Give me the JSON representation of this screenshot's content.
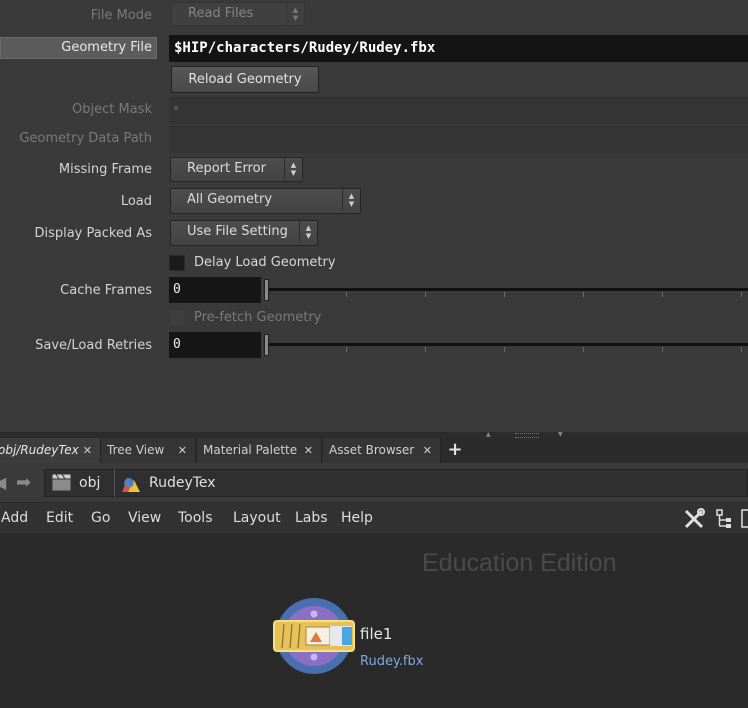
{
  "params": {
    "file_mode": {
      "label": "File Mode",
      "value": "Read Files"
    },
    "geometry_file": {
      "label": "Geometry File",
      "value": "$HIP/characters/Rudey/Rudey.fbx"
    },
    "reload_button": "Reload Geometry",
    "object_mask": {
      "label": "Object Mask",
      "value": "*"
    },
    "geometry_data_path": {
      "label": "Geometry Data Path"
    },
    "missing_frame": {
      "label": "Missing Frame",
      "value": "Report Error"
    },
    "load": {
      "label": "Load",
      "value": "All Geometry"
    },
    "display_packed_as": {
      "label": "Display Packed As",
      "value": "Use File Setting"
    },
    "delay_load": {
      "label": "Delay Load Geometry",
      "checked": false
    },
    "cache_frames": {
      "label": "Cache Frames",
      "value": "0"
    },
    "prefetch": {
      "label": "Pre-fetch Geometry",
      "checked": false
    },
    "save_load_retries": {
      "label": "Save/Load Retries",
      "value": "0"
    }
  },
  "tabs": [
    {
      "label": "obj/RudeyTex",
      "active": true
    },
    {
      "label": "Tree View"
    },
    {
      "label": "Material Palette"
    },
    {
      "label": "Asset Browser"
    }
  ],
  "path": [
    "obj",
    "RudeyTex"
  ],
  "menu": [
    "Add",
    "Edit",
    "Go",
    "View",
    "Tools",
    "Layout",
    "Labs",
    "Help"
  ],
  "network": {
    "watermark": "Education Edition",
    "node": {
      "name": "file1",
      "sublabel": "Rudey.fbx"
    }
  },
  "colors": {
    "node_ring": "#4a6fb0",
    "node_folder": "#e6c15a",
    "node_sublabel": "#7fa9e0",
    "watermark": "#4a4a4a"
  }
}
